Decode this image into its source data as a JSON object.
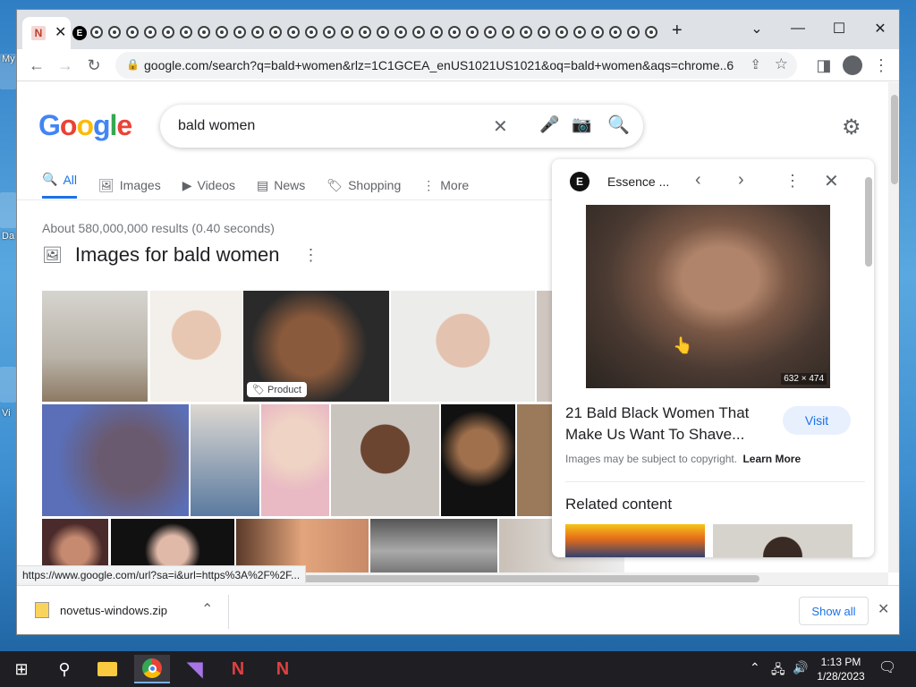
{
  "desktop": {
    "labels": [
      "My",
      "Da",
      "Vi"
    ]
  },
  "browser": {
    "active_tab_icon": "close-icon",
    "new_tab_label": "+",
    "url": "google.com/search?q=bald+women&rlz=1C1GCEA_enUS1021US1021&oq=bald+women&aqs=chrome..6..."
  },
  "google": {
    "logo_text": "Google",
    "query": "bald women",
    "tabs": [
      {
        "label": "All"
      },
      {
        "label": "Images"
      },
      {
        "label": "Videos"
      },
      {
        "label": "News"
      },
      {
        "label": "Shopping"
      },
      {
        "label": "More"
      }
    ],
    "stats": "About 580,000,000 results (0.40 seconds)",
    "images_header": "Images for bald women",
    "product_badge": "Product"
  },
  "panel": {
    "source": "Essence ...",
    "image_size": "632 × 474",
    "title": "21 Bald Black Women That Make Us Want To Shave...",
    "visit_label": "Visit",
    "copyright": "Images may be subject to copyright.",
    "learn_more": "Learn More",
    "related": "Related content"
  },
  "status_url": "https://www.google.com/url?sa=i&url=https%3A%2F%2F...",
  "downloads": {
    "file": "novetus-windows.zip",
    "show_all": "Show all"
  },
  "taskbar": {
    "time": "1:13 PM",
    "date": "1/28/2023"
  },
  "colors": {
    "accent": "#1a73e8",
    "g_blue": "#4285f4",
    "g_red": "#ea4335",
    "g_yellow": "#fbbc05",
    "g_green": "#34a853"
  }
}
